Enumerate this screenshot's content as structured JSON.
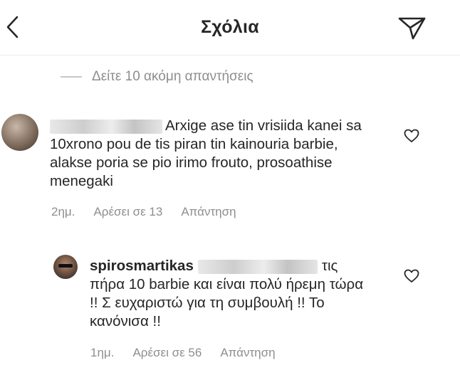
{
  "header": {
    "title": "Σχόλια",
    "back_icon": "chevron-left-icon",
    "send_icon": "paper-plane-icon"
  },
  "more_replies": {
    "label": "Δείτε 10 ακόμη απαντήσεις"
  },
  "comments": [
    {
      "text": "Arxige ase tin vrisiida kanei sa 10xrono pou de tis piran tin kainouria barbie, alakse poria se pio irimo frouto, prosoathise menegaki",
      "time": "2ημ.",
      "likes": "Αρέσει σε 13",
      "reply": "Απάντηση"
    },
    {
      "username": "spirosmartikas",
      "text": "τις πήρα 10 barbie και είναι πολύ ήρεμη τώρα !! Σ ευχαριστώ για τη συμβουλή !! Το κανόνισα !!",
      "time": "1ημ.",
      "likes": "Αρέσει σε 56",
      "reply": "Απάντηση"
    }
  ],
  "colors": {
    "text": "#262626",
    "secondary": "#8e8e8e",
    "divider": "#ececec"
  }
}
